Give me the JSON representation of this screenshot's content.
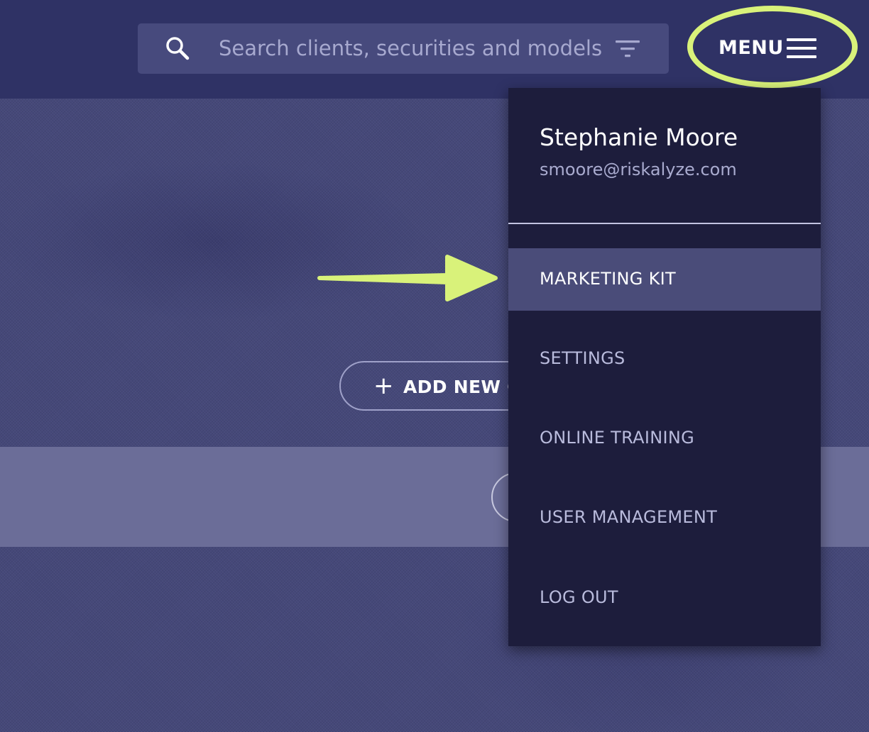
{
  "header": {
    "search": {
      "placeholder": "Search clients, securities and models",
      "icon": "search-icon",
      "filter_icon": "filter-icon"
    },
    "menu_button": {
      "label": "MENU",
      "icon": "hamburger-icon"
    }
  },
  "main": {
    "add_button": {
      "icon": "plus-icon",
      "label_visible": "ADD NEW C"
    }
  },
  "dropdown": {
    "user": {
      "name": "Stephanie Moore",
      "email": "smoore@riskalyze.com"
    },
    "items": [
      {
        "label": "MARKETING KIT",
        "active": true
      },
      {
        "label": "SETTINGS",
        "active": false
      },
      {
        "label": "ONLINE TRAINING",
        "active": false
      },
      {
        "label": "USER MANAGEMENT",
        "active": false
      },
      {
        "label": "LOG OUT",
        "active": false
      }
    ]
  },
  "annotations": {
    "highlight_color": "#d9f27a",
    "arrow": "arrow-pointer",
    "circle": "menu-highlight-ellipse"
  },
  "colors": {
    "topbar": "#2f3265",
    "background": "#454879",
    "dropdown": "#1d1d3c",
    "active_item": "#4a4c79"
  }
}
